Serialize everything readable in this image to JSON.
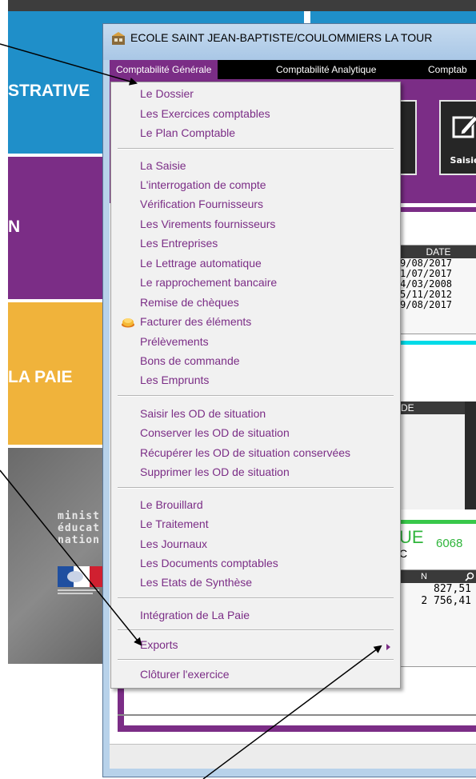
{
  "background": {
    "tiles": {
      "administrative": "STRATIVE",
      "purple": "N",
      "paie": "LA PAIE"
    },
    "ministere_lines": [
      "minist",
      "éducat",
      "nation"
    ]
  },
  "window": {
    "title": "ECOLE SAINT JEAN-BAPTISTE/COULOMMIERS LA TOUR"
  },
  "menubar": {
    "items": [
      "Comptabilité Générale",
      "Comptabilité Analytique",
      "Comptab"
    ]
  },
  "dropdown": {
    "items": {
      "dossier": "Le Dossier",
      "exercices": "Les Exercices comptables",
      "plan": "Le Plan Comptable",
      "saisie": "La Saisie",
      "interrogation": "L'interrogation de compte",
      "verif_fournisseurs": "Vérification Fournisseurs",
      "virements": "Les Virements fournisseurs",
      "entreprises": "Les Entreprises",
      "lettrage": "Le Lettrage automatique",
      "rapprochement": "Le rapprochement bancaire",
      "remise": "Remise de chèques",
      "facturer": "Facturer des éléments",
      "prelevements": "Prélèvements",
      "bons": "Bons de commande",
      "emprunts": "Les Emprunts",
      "saisir_od": "Saisir les OD de situation",
      "conserver_od": "Conserver les OD de situation",
      "recuperer_od": "Récupérer les OD de situation conservées",
      "supprimer_od": "Supprimer les OD de situation",
      "brouillard": "Le Brouillard",
      "traitement": "Le Traitement",
      "journaux": "Les Journaux",
      "documents": "Les Documents comptables",
      "etats": "Les Etats de Synthèse",
      "integration_paie": "Intégration de La Paie",
      "exports": "Exports",
      "cloturer": "Clôturer l'exercice"
    }
  },
  "client": {
    "saisie_button": "Saisie",
    "date_header": "DATE",
    "dates": [
      "9/08/2017",
      "1/07/2017",
      "4/03/2008",
      "5/11/2012",
      "9/08/2017"
    ],
    "de_header": "DE",
    "ue_label": "UE",
    "ue_number": "6068",
    "ue_sub": "C",
    "n_header": "N",
    "amounts": [
      "827,51",
      "2 756,41"
    ]
  },
  "colors": {
    "accent_purple": "#7b2d86",
    "tile_blue": "#1f8fc9",
    "tile_yellow": "#f0b33b",
    "green": "#2fb53b",
    "cyan": "#00dbe8"
  }
}
